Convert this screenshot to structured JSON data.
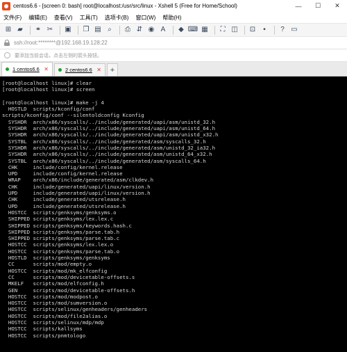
{
  "window": {
    "title": "centos6.6 - [screen 0: bash] root@localhost:/usr/src/linux - Xshell 5 (Free for Home/School)",
    "controls": {
      "minimize": "—",
      "maximize": "☐",
      "close": "✕"
    }
  },
  "menu": {
    "items": [
      "文件(F)",
      "编辑(E)",
      "查看(V)",
      "工具(T)",
      "选项卡(B)",
      "窗口(W)",
      "帮助(H)"
    ]
  },
  "toolbar": {
    "icons": [
      "new-session-icon",
      "open-folder-icon",
      "sep",
      "connect-icon",
      "disconnect-icon",
      "sep",
      "reconnect-icon",
      "sep",
      "copy-icon",
      "paste-icon",
      "find-icon",
      "sep",
      "print-icon",
      "transfer-icon",
      "globe-icon",
      "font-icon",
      "sep",
      "xftp-icon",
      "keyboard-icon",
      "lock-icon",
      "sep",
      "fullscreen-icon",
      "transparent-icon",
      "sep",
      "compose-icon",
      "layout-icon",
      "sep",
      "help-icon",
      "sep"
    ]
  },
  "address": {
    "text": "ssh://root:********@192.168.19.128:22"
  },
  "hint": {
    "text": "要添加当前会话，点击左侧的箭头按钮。"
  },
  "tabs": [
    {
      "label": "1 centos6.6",
      "active": true,
      "dot_color": "#1e9e2e"
    },
    {
      "label": "2 centos6.6",
      "active": false,
      "dot_color": "#1e9e2e"
    }
  ],
  "tab_add": "+",
  "terminal": {
    "lines": [
      "[root@localhost linux]# clear",
      "[root@localhost linux]# screen",
      "",
      "[root@localhost linux]# make -j 4",
      "  HOSTLD  scripts/kconfig/conf",
      "scripts/kconfig/conf --silentoldconfig Kconfig",
      "  SYSHDR  arch/x86/syscalls/../include/generated/uapi/asm/unistd_32.h",
      "  SYSHDR  arch/x86/syscalls/../include/generated/uapi/asm/unistd_64.h",
      "  SYSHDR  arch/x86/syscalls/../include/generated/uapi/asm/unistd_x32.h",
      "  SYSTBL  arch/x86/syscalls/../include/generated/asm/syscalls_32.h",
      "  SYSHDR  arch/x86/syscalls/../include/generated/asm/unistd_32_ia32.h",
      "  SYSHDR  arch/x86/syscalls/../include/generated/asm/unistd_64_x32.h",
      "  SYSTBL  arch/x86/syscalls/../include/generated/asm/syscalls_64.h",
      "  CHK     include/config/kernel.release",
      "  UPD     include/config/kernel.release",
      "  WRAP    arch/x86/include/generated/asm/clkdev.h",
      "  CHK     include/generated/uapi/linux/version.h",
      "  UPD     include/generated/uapi/linux/version.h",
      "  CHK     include/generated/utsrelease.h",
      "  UPD     include/generated/utsrelease.h",
      "  HOSTCC  scripts/genksyms/genksyms.o",
      "  SHIPPED scripts/genksyms/lex.lex.c",
      "  SHIPPED scripts/genksyms/keywords.hash.c",
      "  SHIPPED scripts/genksyms/parse.tab.h",
      "  SHIPPED scripts/genksyms/parse.tab.c",
      "  HOSTCC  scripts/genksyms/lex.lex.o",
      "  HOSTCC  scripts/genksyms/parse.tab.o",
      "  HOSTLD  scripts/genksyms/genksyms",
      "  CC      scripts/mod/empty.o",
      "  HOSTCC  scripts/mod/mk_elfconfig",
      "  CC      scripts/mod/devicetable-offsets.s",
      "  MKELF   scripts/mod/elfconfig.h",
      "  GEN     scripts/mod/devicetable-offsets.h",
      "  HOSTCC  scripts/mod/modpost.o",
      "  HOSTCC  scripts/mod/sumversion.o",
      "  HOSTCC  scripts/selinux/genheaders/genheaders",
      "  HOSTCC  scripts/mod/file2alias.o",
      "  HOSTCC  scripts/selinux/mdp/mdp",
      "  HOSTCC  scripts/kallsyms",
      "  HOSTCC  scripts/pnmtologo"
    ]
  }
}
